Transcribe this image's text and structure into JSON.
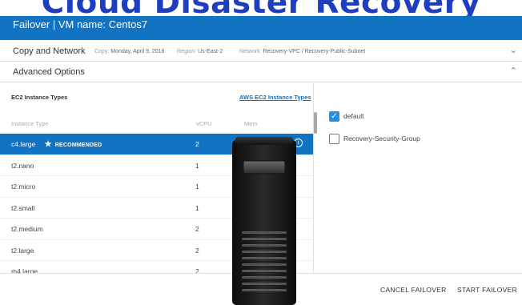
{
  "banner": {
    "title": "Cloud Disaster Recovery"
  },
  "header": {
    "title": "Failover | VM name: Centos7"
  },
  "copy_network": {
    "label": "Copy and Network",
    "copy_key": "Copy:",
    "copy_value": "Monday, April 9, 2018",
    "region_key": "Region:",
    "region_value": "Us-East-2",
    "network_key": "Network:",
    "network_value": "Recovery-VPC / Recovery-Public-Subnet",
    "chevron_icon": "chevron-down-icon"
  },
  "advanced": {
    "label": "Advanced Options",
    "chevron_icon": "chevron-up-icon"
  },
  "ec2": {
    "title": "EC2 Instance Types",
    "link": "AWS EC2 Instance Types",
    "columns": {
      "type": "Instance Type",
      "vcpu": "vCPU",
      "mem": "Mem"
    },
    "recommended_label": "RECOMMENDED",
    "rows": [
      {
        "type": "c4.large",
        "vcpu": "2",
        "recommended": true,
        "selected": true
      },
      {
        "type": "t2.nano",
        "vcpu": "1"
      },
      {
        "type": "t2.micro",
        "vcpu": "1"
      },
      {
        "type": "t2.small",
        "vcpu": "1"
      },
      {
        "type": "t2.medium",
        "vcpu": "2"
      },
      {
        "type": "t2.large",
        "vcpu": "2"
      },
      {
        "type": "m4.large",
        "vcpu": "2"
      }
    ]
  },
  "security_groups": [
    {
      "label": "default",
      "checked": true
    },
    {
      "label": "Recovery-Security-Group",
      "checked": false
    }
  ],
  "footer": {
    "cancel": "CANCEL FAILOVER",
    "start": "START FAILOVER"
  },
  "colors": {
    "header_blue": "#1173c2",
    "selected_row": "#1173c2",
    "banner_text": "#1d3fbf",
    "checkbox": "#2b8fe0"
  }
}
